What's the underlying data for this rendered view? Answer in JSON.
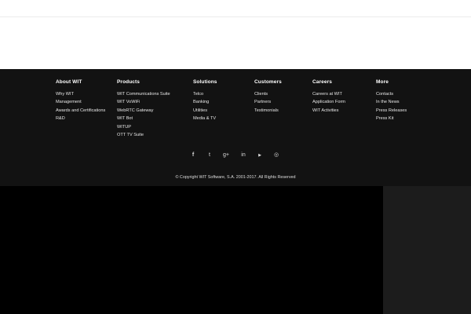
{
  "footer": {
    "columns": [
      {
        "title": "About WIT",
        "items": [
          "Why WIT",
          "Management",
          "Awards and Certifications",
          "R&D"
        ]
      },
      {
        "title": "Products",
        "items": [
          "WIT Communications Suite",
          "WIT VoWiFi",
          "WebRTC Gateway",
          "WIT Bot",
          "WITUP",
          "OTT TV Suite"
        ]
      },
      {
        "title": "Solutions",
        "items": [
          "Telco",
          "Banking",
          "Utilities",
          "Media & TV"
        ]
      },
      {
        "title": "Customers",
        "items": [
          "Clients",
          "Partners",
          "Testimonials"
        ]
      },
      {
        "title": "Careers",
        "items": [
          "Careers at WIT",
          "Application Form",
          "WIT Activities"
        ]
      },
      {
        "title": "More",
        "items": [
          "Contacts",
          "In the News",
          "Press Releases",
          "Press Kit"
        ]
      }
    ],
    "social": [
      {
        "icon": "facebook-icon",
        "glyph": "f"
      },
      {
        "icon": "twitter-icon",
        "glyph": "t"
      },
      {
        "icon": "google-plus-icon",
        "glyph": "g+"
      },
      {
        "icon": "linkedin-icon",
        "glyph": "in"
      },
      {
        "icon": "youtube-icon",
        "glyph": "▶"
      },
      {
        "icon": "instagram-icon",
        "glyph": "◎"
      }
    ],
    "copyright": "© Copyright WIT Software, S.A. 2001-2017. All Rights Reserved"
  },
  "colors": {
    "footer_bg": "#121212",
    "text": "#e6e6e6",
    "panel_gray": "#1c1c1c"
  }
}
